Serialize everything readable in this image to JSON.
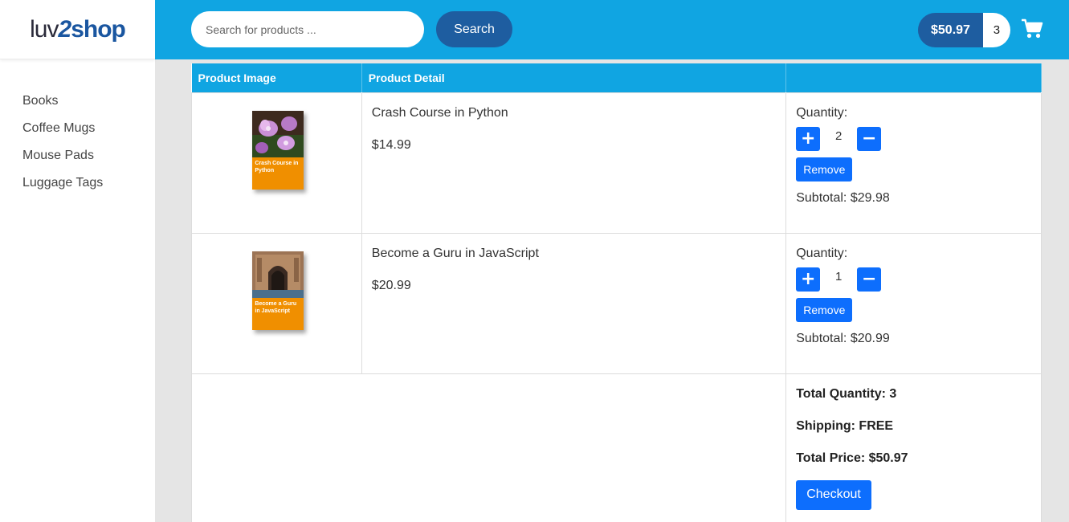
{
  "brand": {
    "logo_part1": "luv",
    "logo_part2": "2",
    "logo_part3": "shop"
  },
  "sidebar": {
    "items": [
      {
        "label": "Books"
      },
      {
        "label": "Coffee Mugs"
      },
      {
        "label": "Mouse Pads"
      },
      {
        "label": "Luggage Tags"
      }
    ]
  },
  "header": {
    "search_placeholder": "Search for products ...",
    "search_button": "Search",
    "cart_total": "$50.97",
    "cart_count": "3",
    "cart_icon": "shopping-cart-icon"
  },
  "table": {
    "headers": [
      "Product Image",
      "Product Detail",
      ""
    ],
    "items": [
      {
        "image_title": "Crash Course in Python",
        "name": "Crash Course in Python",
        "price": "$14.99",
        "quantity_label": "Quantity:",
        "quantity": "2",
        "remove_label": "Remove",
        "subtotal": "Subtotal: $29.98"
      },
      {
        "image_title": "Become a Guru in JavaScript",
        "name": "Become a Guru in JavaScript",
        "price": "$20.99",
        "quantity_label": "Quantity:",
        "quantity": "1",
        "remove_label": "Remove",
        "subtotal": "Subtotal: $20.99"
      }
    ],
    "totals": {
      "total_quantity": "Total Quantity: 3",
      "shipping": "Shipping: FREE",
      "total_price": "Total Price: $50.97",
      "checkout_label": "Checkout"
    }
  },
  "colors": {
    "header_bg": "#10a5e2",
    "dark_blue": "#1e5da0",
    "button_blue": "#0d6efd",
    "book_orange": "#f08f00"
  }
}
